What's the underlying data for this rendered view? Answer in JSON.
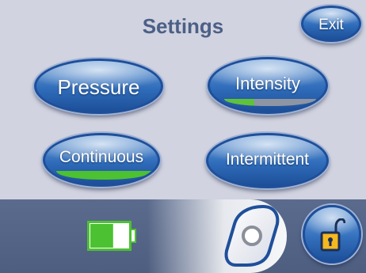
{
  "header": {
    "title": "Settings",
    "exit_label": "Exit"
  },
  "buttons": {
    "pressure": "Pressure",
    "intensity": "Intensity",
    "continuous": "Continuous",
    "intermittent": "Intermittent"
  },
  "intensity_level": 0.33,
  "continuous_active": true,
  "battery_level": 0.6,
  "icons": {
    "battery": "battery-icon",
    "slider": "unlock-slider-knob-icon",
    "lock": "unlocked-padlock-icon"
  },
  "colors": {
    "background": "#d1d3e0",
    "title": "#4c5f86",
    "button_blue": "#2f6cba",
    "indicator_green": "#5fc23a",
    "bottom_bar": "#55658a"
  }
}
